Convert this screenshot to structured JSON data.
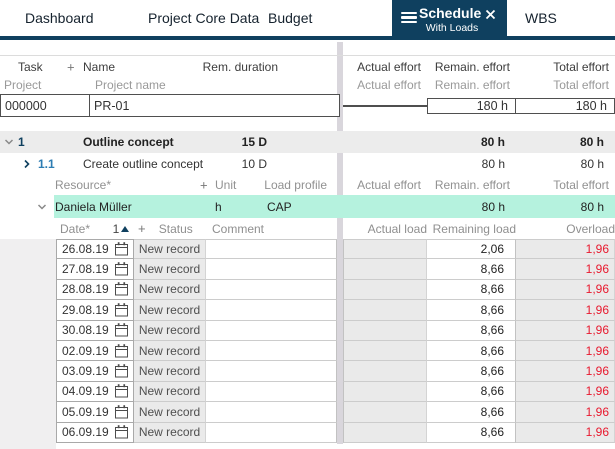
{
  "tabs": [
    {
      "label": "Dashboard"
    },
    {
      "label": "Project Core Data"
    },
    {
      "label": "Budget"
    },
    {
      "label": "Schedule",
      "subtitle": "With Loads",
      "active": true
    },
    {
      "label": "WBS"
    }
  ],
  "main_table": {
    "header_row": {
      "task": "Task",
      "add": "+",
      "name": "Name",
      "rem_duration": "Rem. duration",
      "actual_effort": "Actual effort",
      "remain_effort": "Remain. effort",
      "total_effort": "Total effort"
    },
    "subheader_row": {
      "project": "Project",
      "project_name": "Project name",
      "actual_effort": "Actual effort",
      "remain_effort": "Remain. effort",
      "total_effort": "Total effort"
    },
    "project_row": {
      "id": "000000",
      "name": "PR-01",
      "actual_effort": "",
      "remain_effort": "180 h",
      "total_effort": "180 h"
    },
    "task_rows": [
      {
        "wbs": "1",
        "name": "Outline concept",
        "rem_duration": "15 D",
        "actual_effort": "",
        "remain_effort": "80 h",
        "total_effort": "80 h"
      },
      {
        "wbs": "1.1",
        "name": "Create outline concept",
        "rem_duration": "10 D",
        "actual_effort": "",
        "remain_effort": "80 h",
        "total_effort": "80 h"
      }
    ],
    "resource_header": {
      "resource": "Resource*",
      "add": "+",
      "unit": "Unit",
      "load_profile": "Load profile",
      "actual_effort": "Actual effort",
      "remain_effort": "Remain. effort",
      "total_effort": "Total effort"
    },
    "resource_row": {
      "name": "Daniela Müller",
      "unit": "h",
      "load_profile": "CAP",
      "actual_effort": "",
      "remain_effort": "80 h",
      "total_effort": "80 h"
    },
    "load_header": {
      "date": "Date*",
      "sort_order": "1",
      "add": "+",
      "status": "Status",
      "comment": "Comment",
      "actual_load": "Actual load",
      "remaining_load": "Remaining load",
      "overload": "Overload"
    },
    "load_rows": [
      {
        "date": "26.08.19",
        "status": "New record",
        "comment": "",
        "actual_load": "",
        "remaining_load": "2,06",
        "overload": "1,96"
      },
      {
        "date": "27.08.19",
        "status": "New record",
        "comment": "",
        "actual_load": "",
        "remaining_load": "8,66",
        "overload": "1,96"
      },
      {
        "date": "28.08.19",
        "status": "New record",
        "comment": "",
        "actual_load": "",
        "remaining_load": "8,66",
        "overload": "1,96"
      },
      {
        "date": "29.08.19",
        "status": "New record",
        "comment": "",
        "actual_load": "",
        "remaining_load": "8,66",
        "overload": "1,96"
      },
      {
        "date": "30.08.19",
        "status": "New record",
        "comment": "",
        "actual_load": "",
        "remaining_load": "8,66",
        "overload": "1,96"
      },
      {
        "date": "02.09.19",
        "status": "New record",
        "comment": "",
        "actual_load": "",
        "remaining_load": "8,66",
        "overload": "1,96"
      },
      {
        "date": "03.09.19",
        "status": "New record",
        "comment": "",
        "actual_load": "",
        "remaining_load": "8,66",
        "overload": "1,96"
      },
      {
        "date": "04.09.19",
        "status": "New record",
        "comment": "",
        "actual_load": "",
        "remaining_load": "8,66",
        "overload": "1,96"
      },
      {
        "date": "05.09.19",
        "status": "New record",
        "comment": "",
        "actual_load": "",
        "remaining_load": "8,66",
        "overload": "1,96"
      },
      {
        "date": "06.09.19",
        "status": "New record",
        "comment": "",
        "actual_load": "",
        "remaining_load": "8,66",
        "overload": "1,96"
      }
    ]
  },
  "colors": {
    "brand_navy": "#0f405f",
    "mint_highlight": "#b5f2de",
    "overload_red": "#e8192e",
    "summary_row_gray": "#ececec",
    "readonly_cell_gray": "#eaeaea"
  }
}
